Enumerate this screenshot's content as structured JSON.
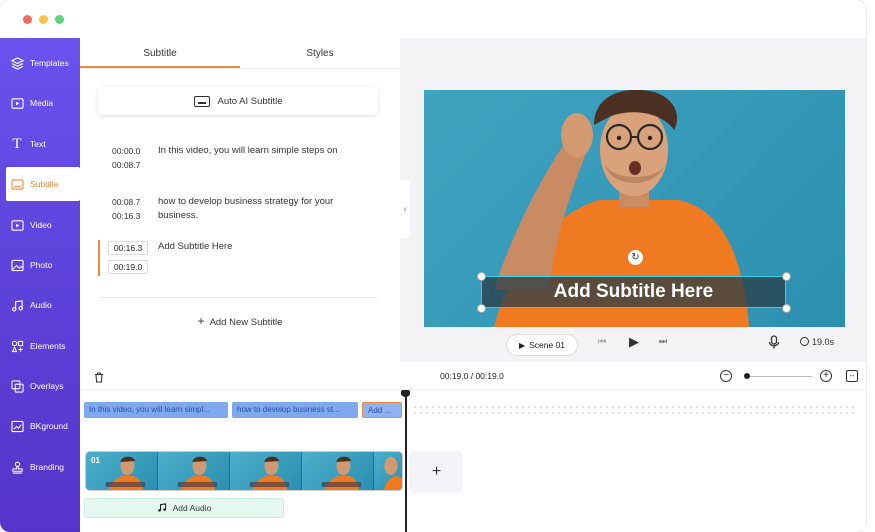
{
  "sidebar": {
    "items": [
      {
        "label": "Templates",
        "icon": "layers-icon"
      },
      {
        "label": "Media",
        "icon": "media-folder-icon"
      },
      {
        "label": "Text",
        "icon": "text-icon"
      },
      {
        "label": "Subtitle",
        "icon": "subtitle-icon"
      },
      {
        "label": "Video",
        "icon": "video-icon"
      },
      {
        "label": "Photo",
        "icon": "photo-icon"
      },
      {
        "label": "Audio",
        "icon": "music-note-icon"
      },
      {
        "label": "Elements",
        "icon": "elements-icon"
      },
      {
        "label": "Overlays",
        "icon": "overlays-icon"
      },
      {
        "label": "BKground",
        "icon": "background-icon"
      },
      {
        "label": "Branding",
        "icon": "stamp-icon"
      }
    ],
    "active": "Subtitle"
  },
  "panel": {
    "tabs": [
      "Subtitle",
      "Styles"
    ],
    "auto_btn": "Auto AI Subtitle",
    "subtitles": [
      {
        "start": "00:00.0",
        "end": "00:08.7",
        "text": "In this video, you will learn simple steps on"
      },
      {
        "start": "00:08.7",
        "end": "00:16.3",
        "text": "how to develop business strategy for your business."
      },
      {
        "start": "00:16.3",
        "end": "00:19.0",
        "text": "Add Subtitle Here"
      }
    ],
    "add_btn": "Add New Subtitle"
  },
  "preview": {
    "overlay_text": "Add Subtitle Here",
    "scene_label": "Scene 01",
    "duration": "19.0s"
  },
  "timeline": {
    "time": "00:19.0 / 00:19.0",
    "clips": [
      "In this video, you will learn simpl...",
      "how to develop business st...",
      "Add ..."
    ],
    "strip_label": "01",
    "add_audio": "Add Audio"
  },
  "colors": {
    "accent": "#ef8a3c",
    "sidebar": "#5b3fd6",
    "subtitle_clip": "#7fa8ee",
    "overlay_border": "#2fd3e6"
  }
}
